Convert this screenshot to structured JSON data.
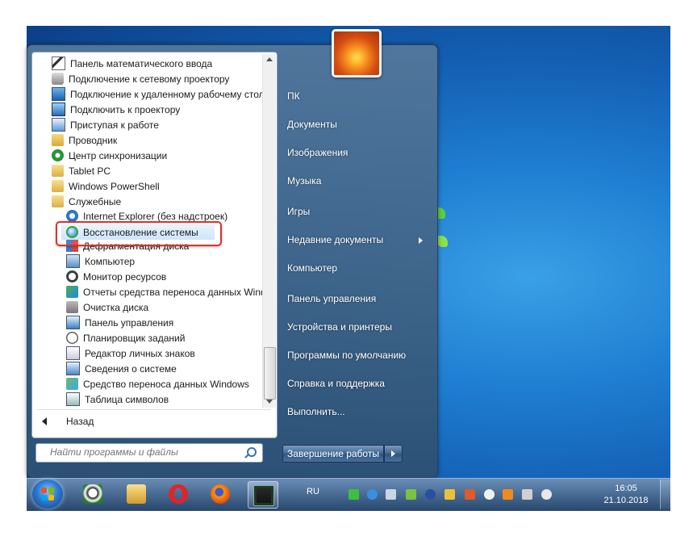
{
  "programs": {
    "items": [
      {
        "label": "Панель математического ввода",
        "icon": "math-input-icon",
        "level": 1
      },
      {
        "label": "Подключение к сетевому проектору",
        "icon": "network-projector-icon",
        "level": 1
      },
      {
        "label": "Подключение к удаленному рабочему стол",
        "icon": "remote-desktop-icon",
        "level": 1
      },
      {
        "label": "Подключить к проектору",
        "icon": "projector-icon",
        "level": 1
      },
      {
        "label": "Приступая к работе",
        "icon": "getting-started-icon",
        "level": 1
      },
      {
        "label": "Проводник",
        "icon": "explorer-folder-icon",
        "level": 1
      },
      {
        "label": "Центр синхронизации",
        "icon": "sync-center-icon",
        "level": 1
      },
      {
        "label": "Tablet PC",
        "icon": "folder-icon",
        "level": 1
      },
      {
        "label": "Windows PowerShell",
        "icon": "folder-icon",
        "level": 1
      },
      {
        "label": "Служебные",
        "icon": "folder-open-icon",
        "level": 1
      },
      {
        "label": "Internet Explorer (без надстроек)",
        "icon": "internet-explorer-icon",
        "level": 2
      },
      {
        "label": "Восстановление системы",
        "icon": "system-restore-icon",
        "level": 2,
        "highlighted": true
      },
      {
        "label": "Дефрагментация диска",
        "icon": "defrag-icon",
        "level": 2
      },
      {
        "label": "Компьютер",
        "icon": "computer-icon",
        "level": 2
      },
      {
        "label": "Монитор ресурсов",
        "icon": "resource-monitor-icon",
        "level": 2
      },
      {
        "label": "Отчеты средства переноса данных Windo",
        "icon": "transfer-report-icon",
        "level": 2
      },
      {
        "label": "Очистка диска",
        "icon": "disk-cleanup-icon",
        "level": 2
      },
      {
        "label": "Панель управления",
        "icon": "control-panel-icon",
        "level": 2
      },
      {
        "label": "Планировщик заданий",
        "icon": "task-scheduler-icon",
        "level": 2
      },
      {
        "label": "Редактор личных знаков",
        "icon": "char-editor-icon",
        "level": 2
      },
      {
        "label": "Сведения о системе",
        "icon": "system-info-icon",
        "level": 2
      },
      {
        "label": "Средство переноса данных Windows",
        "icon": "easy-transfer-icon",
        "level": 2
      },
      {
        "label": "Таблица символов",
        "icon": "charmap-icon",
        "level": 2
      }
    ],
    "back_label": "Назад",
    "highlight_color": "#d9332d"
  },
  "search": {
    "placeholder": "Найти программы и файлы"
  },
  "right_pane": {
    "items": [
      {
        "label": "ПК"
      },
      {
        "label": "Документы"
      },
      {
        "label": "Изображения"
      },
      {
        "label": "Музыка"
      },
      {
        "label": "Игры"
      },
      {
        "label": "Недавние документы",
        "has_submenu": true
      },
      {
        "label": "Компьютер"
      },
      {
        "label": "Панель управления"
      },
      {
        "label": "Устройства и принтеры"
      },
      {
        "label": "Программы по умолчанию"
      },
      {
        "label": "Справка и поддержка"
      },
      {
        "label": "Выполнить..."
      }
    ],
    "shutdown_label": "Завершение работы"
  },
  "taskbar": {
    "pinned": [
      {
        "icon": "panda-icon"
      },
      {
        "icon": "file-explorer-icon"
      },
      {
        "icon": "opera-icon"
      },
      {
        "icon": "firefox-icon"
      },
      {
        "icon": "terminal-icon",
        "active": true
      }
    ],
    "language": "RU",
    "tray_icons": [
      "network-icon",
      "antivirus-icon",
      "settings-icon",
      "nvidia-icon",
      "save-icon",
      "usb-icon",
      "update-icon",
      "flag-icon",
      "avast-icon",
      "signal-icon",
      "volume-icon"
    ],
    "time": "16:05",
    "date": "21.10.2018"
  }
}
